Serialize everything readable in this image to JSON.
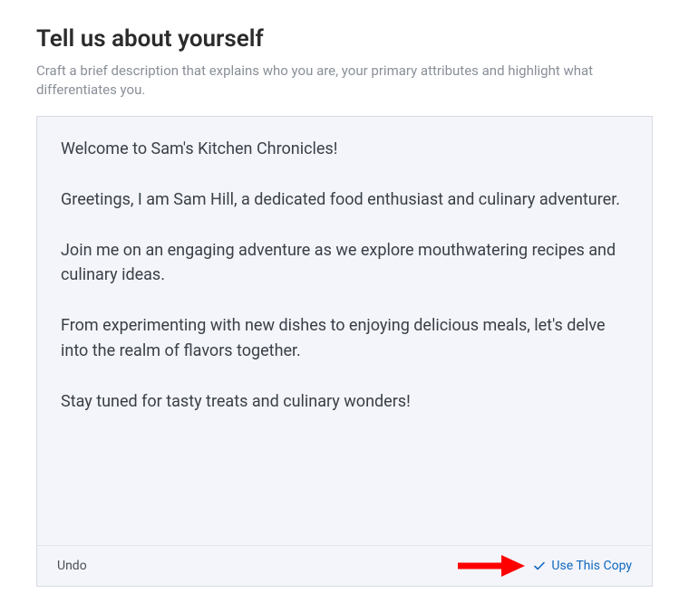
{
  "header": {
    "title": "Tell us about yourself",
    "subtitle": "Craft a brief description that explains who you are, your primary attributes and highlight what differentiates you."
  },
  "editor": {
    "content": "Welcome to Sam's Kitchen Chronicles!\n\nGreetings, I am Sam Hill, a dedicated food enthusiast and culinary adventurer.\n\nJoin me on an engaging adventure as we explore mouthwatering recipes and culinary ideas.\n\nFrom experimenting with new dishes to enjoying delicious meals, let's delve into the realm of flavors together.\n\nStay tuned for tasty treats and culinary wonders!"
  },
  "footer": {
    "undo_label": "Undo",
    "use_copy_label": "Use This Copy"
  },
  "colors": {
    "accent": "#1068bf",
    "annotation": "#ff0000"
  }
}
